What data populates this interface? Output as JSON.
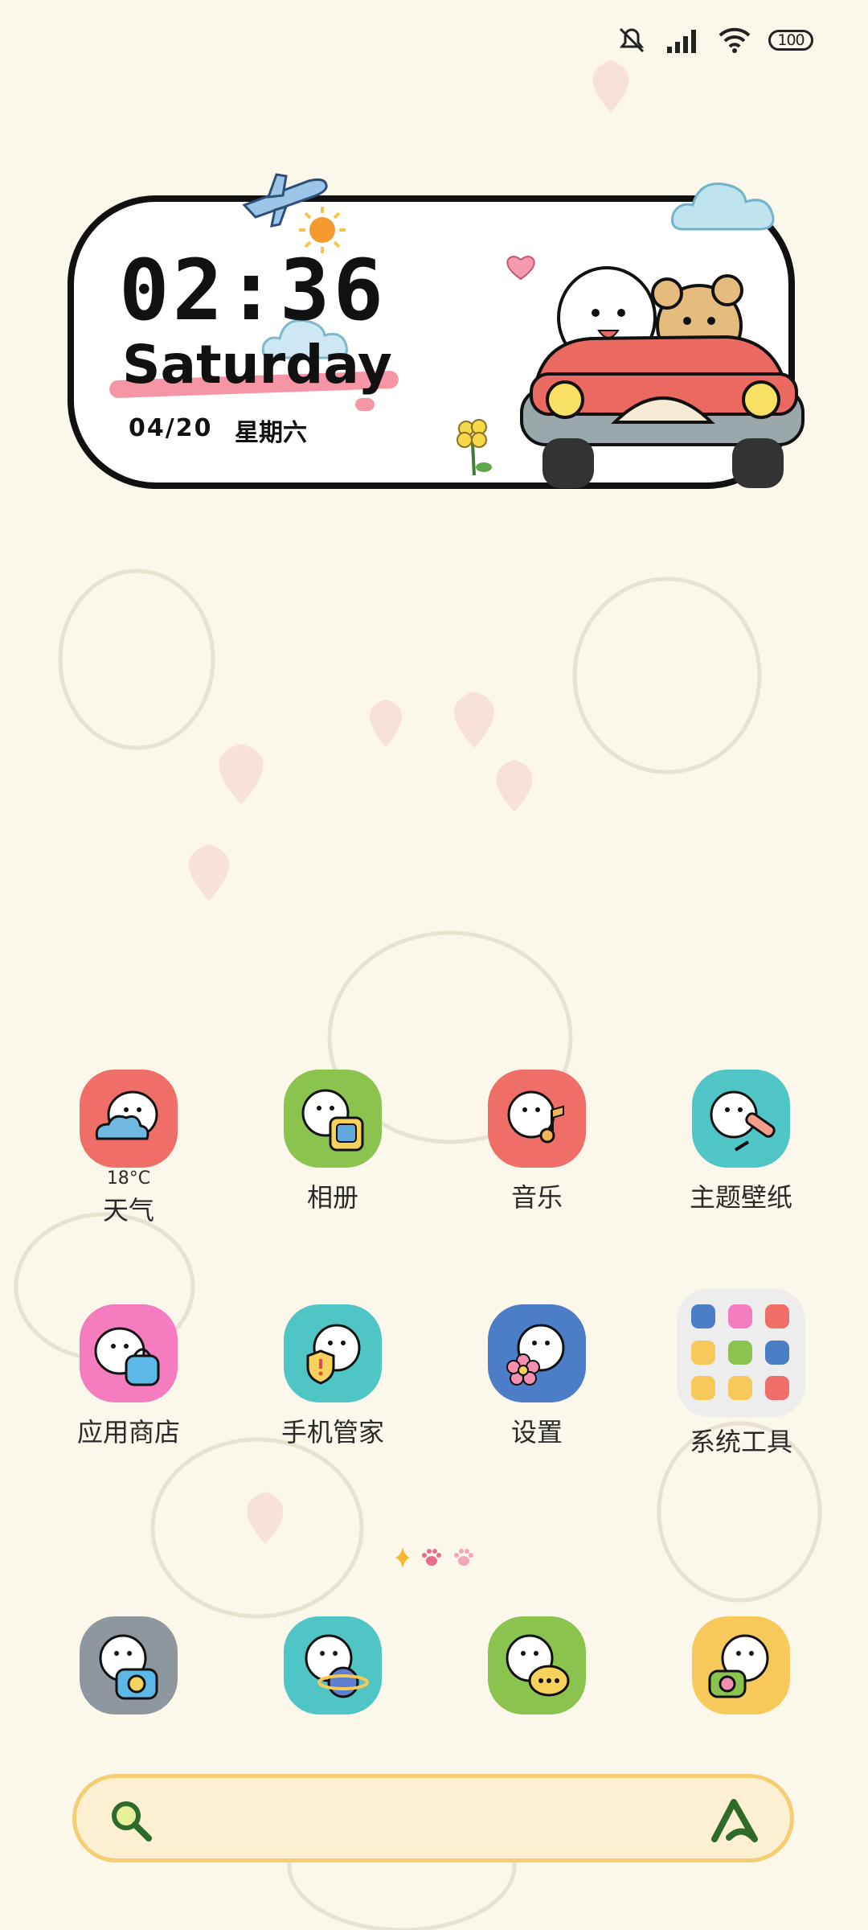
{
  "status_bar": {
    "battery": "100",
    "icons": [
      "mute-icon",
      "signal-icon",
      "wifi-icon",
      "battery-icon"
    ]
  },
  "clock_widget": {
    "time": "02:36",
    "day": "Saturday",
    "date": "04/20",
    "weekday": "星期六"
  },
  "apps": [
    {
      "label": "天气",
      "temp": "18°C",
      "color": "#ef6e67",
      "icon": "weather-icon"
    },
    {
      "label": "相册",
      "color": "#8bc34f",
      "icon": "gallery-icon"
    },
    {
      "label": "音乐",
      "color": "#ef6e67",
      "icon": "music-icon"
    },
    {
      "label": "主题壁纸",
      "color": "#4fc5c6",
      "icon": "themes-icon"
    },
    {
      "label": "应用商店",
      "color": "#f47cbf",
      "icon": "app-store-icon"
    },
    {
      "label": "手机管家",
      "color": "#4fc5c6",
      "icon": "security-icon"
    },
    {
      "label": "设置",
      "color": "#4c7ec7",
      "icon": "settings-icon"
    },
    {
      "label": "系统工具",
      "icon": "folder-icon"
    }
  ],
  "dock": [
    {
      "color": "#8e979e",
      "icon": "camera-icon"
    },
    {
      "color": "#4fc5c6",
      "icon": "browser-icon"
    },
    {
      "color": "#8bc34f",
      "icon": "messages-icon"
    },
    {
      "color": "#f6c95a",
      "icon": "phone-icon"
    }
  ],
  "pager": [
    "sparkle-icon",
    "paw-icon",
    "paw-icon"
  ],
  "search_bar": {
    "icon": "search-icon",
    "assistant_icon": "assistant-icon"
  }
}
